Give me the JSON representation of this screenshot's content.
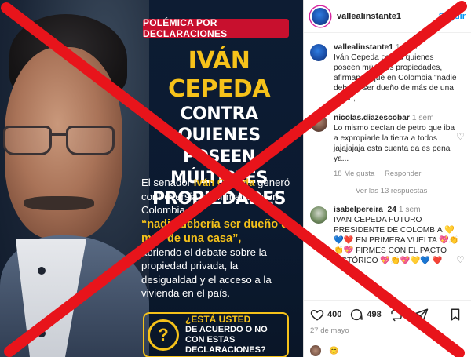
{
  "post_image": {
    "topic_badge": "POLÉMICA POR DECLARACIONES",
    "headline": {
      "name": "IVÁN CEPEDA",
      "line1": "CONTRA QUIENES",
      "line2": "POSEEN MÚLTIPLES",
      "line3": "PROPIEDADES"
    },
    "body": {
      "p1_pre": "El senador ",
      "p1_name": "Iván Cepeda",
      "p1_post": " generó controversia al afirmar que en Colombia",
      "quote": "“nadie debería ser dueño de más de una casa”,",
      "p2": "abriendo el debate sobre la propiedad privada, la desigualdad y el acceso a la vivienda en el país."
    },
    "question": {
      "icon": "?",
      "line1": "¿ESTÁ USTED",
      "line2": "DE ACUERDO O NO",
      "line3": "CON ESTAS DECLARACIONES?"
    }
  },
  "instagram": {
    "header": {
      "username": "vallealinstante1",
      "follow_label": "Seguir"
    },
    "comments": [
      {
        "user": "vallealinstante1",
        "time": "1 sem",
        "text": "Iván Cepeda contra quienes poseen múltiples propiedades, afirmando que en Colombia \"nadie debería ser dueño de más de una casa\","
      },
      {
        "user": "nicolas.diazescobar",
        "time": "1 sem",
        "text": "Lo mismo decían de petro que iba a expropiarle la tierra a todos jajajajaja esta cuenta da es pena ya...",
        "likes": "18 Me gusta",
        "reply_label": "Responder",
        "view_replies": "Ver las 13 respuestas"
      },
      {
        "user": "isabelpereira_24",
        "time": "1 sem",
        "text": "IVAN CEPEDA FUTURO PRESIDENTE DE COLOMBIA 💛💙❤️ EN PRIMERA VUELTA 💖👏👏💖 FIRMES CON EL PACTO HISTÓRICO 💖👏💖💛💙 ❤️"
      }
    ],
    "actions": {
      "likes_count": "400",
      "comments_count": "498"
    },
    "post_date": "27 de mayo",
    "footer_emoji": "😊"
  },
  "colors": {
    "badge_red": "#c8102e",
    "highlight_yellow": "#f6c21a",
    "cross_red": "#e8141b",
    "ig_link_blue": "#0095f6"
  }
}
